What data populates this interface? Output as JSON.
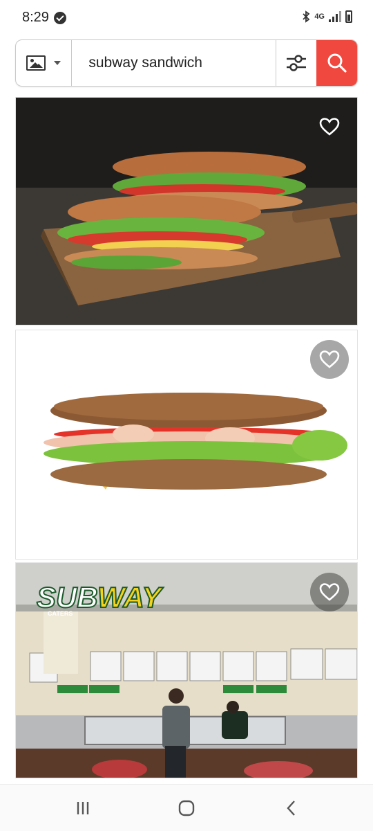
{
  "status_bar": {
    "time": "8:29",
    "network": "4G",
    "icons": [
      "check-circle-icon",
      "bluetooth-icon",
      "network-4g-icon",
      "signal-icon",
      "battery-icon"
    ]
  },
  "search": {
    "query": "subway sandwich",
    "type_icon": "image-icon",
    "filter_icon": "sliders-icon",
    "submit_icon": "search-icon",
    "accent_color": "#f0483e"
  },
  "results": {
    "tiles": [
      {
        "subject": "two sub sandwiches on wooden board",
        "favorite_icon": "heart-outline-icon"
      },
      {
        "subject": "sub sandwich on white background",
        "favorite_icon": "heart-outline-icon"
      },
      {
        "subject": "SUBWAY restaurant counter",
        "sign_text": "SUBWAY",
        "sub_text": "CATERS",
        "favorite_icon": "heart-outline-icon"
      }
    ]
  },
  "nav_bar": {
    "buttons": [
      "recent-apps-icon",
      "home-icon",
      "back-icon"
    ]
  }
}
